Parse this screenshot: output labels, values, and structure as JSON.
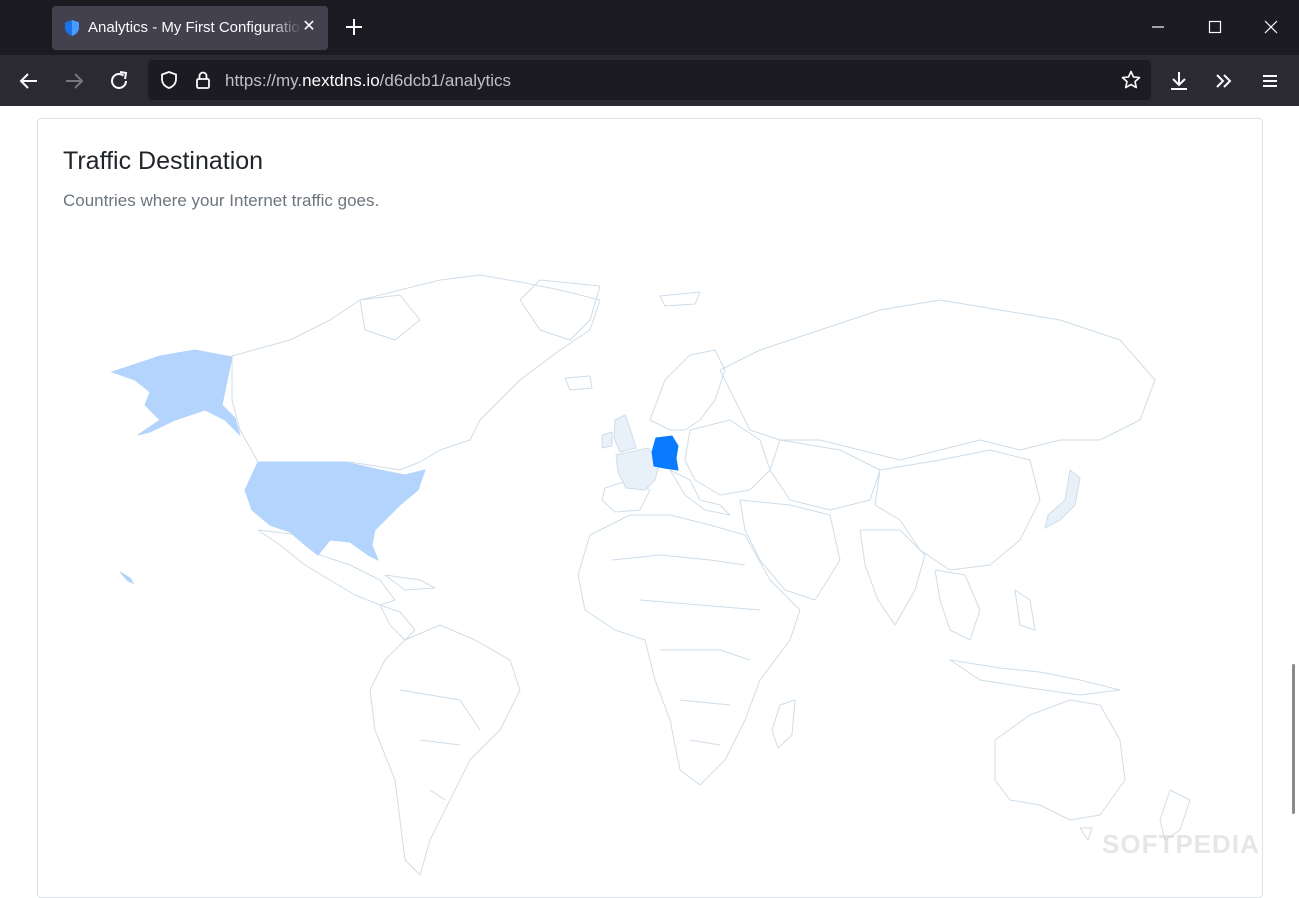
{
  "browser": {
    "tab_title": "Analytics - My First Configuration",
    "url_prefix": "https://my.",
    "url_domain": "nextdns.io",
    "url_path": "/d6dcb1/analytics"
  },
  "card": {
    "title": "Traffic Destination",
    "subtitle": "Countries where your Internet traffic goes."
  },
  "map": {
    "highlighted_countries": [
      {
        "name": "Germany",
        "level": "high",
        "color": "#0a7bff"
      },
      {
        "name": "United States",
        "level": "medium",
        "color": "#b3d4fc"
      },
      {
        "name": "France",
        "level": "low",
        "color": "#e8f0fa"
      },
      {
        "name": "United Kingdom",
        "level": "low",
        "color": "#e8f0fa"
      },
      {
        "name": "Japan",
        "level": "low",
        "color": "#e8f0fa"
      }
    ],
    "outline_color": "#cfdde8"
  },
  "watermark": "SOFTPEDIA"
}
